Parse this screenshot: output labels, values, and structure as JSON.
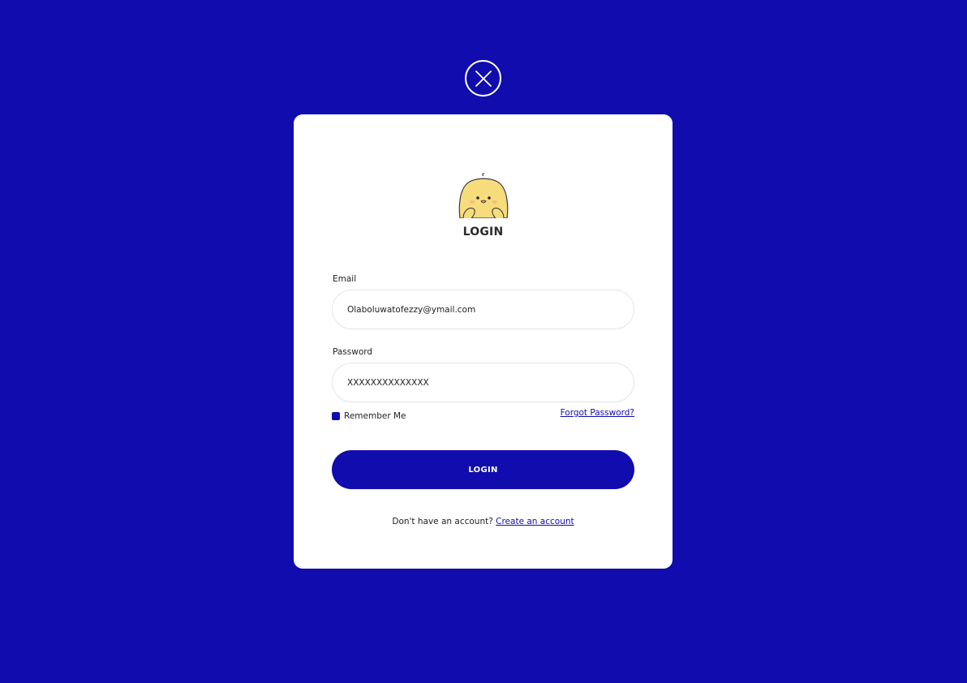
{
  "close": {
    "icon": "close-icon"
  },
  "mascot": {
    "icon": "chick-mascot-icon"
  },
  "title": "LOGIN",
  "email": {
    "label": "Email",
    "value": "Olaboluwatofezzy@ymail.com"
  },
  "password": {
    "label": "Password",
    "value": "XXXXXXXXXXXXXX"
  },
  "remember": {
    "label": "Remember Me",
    "checked": true
  },
  "forgot": "Forgot Password?",
  "login_button": "LOGIN",
  "signup": {
    "prompt": "Don't have an account?",
    "link": "Create an account"
  },
  "colors": {
    "background": "#100cae",
    "card": "#ffffff",
    "accent": "#100cae",
    "mascot": "#f7dc7c"
  }
}
